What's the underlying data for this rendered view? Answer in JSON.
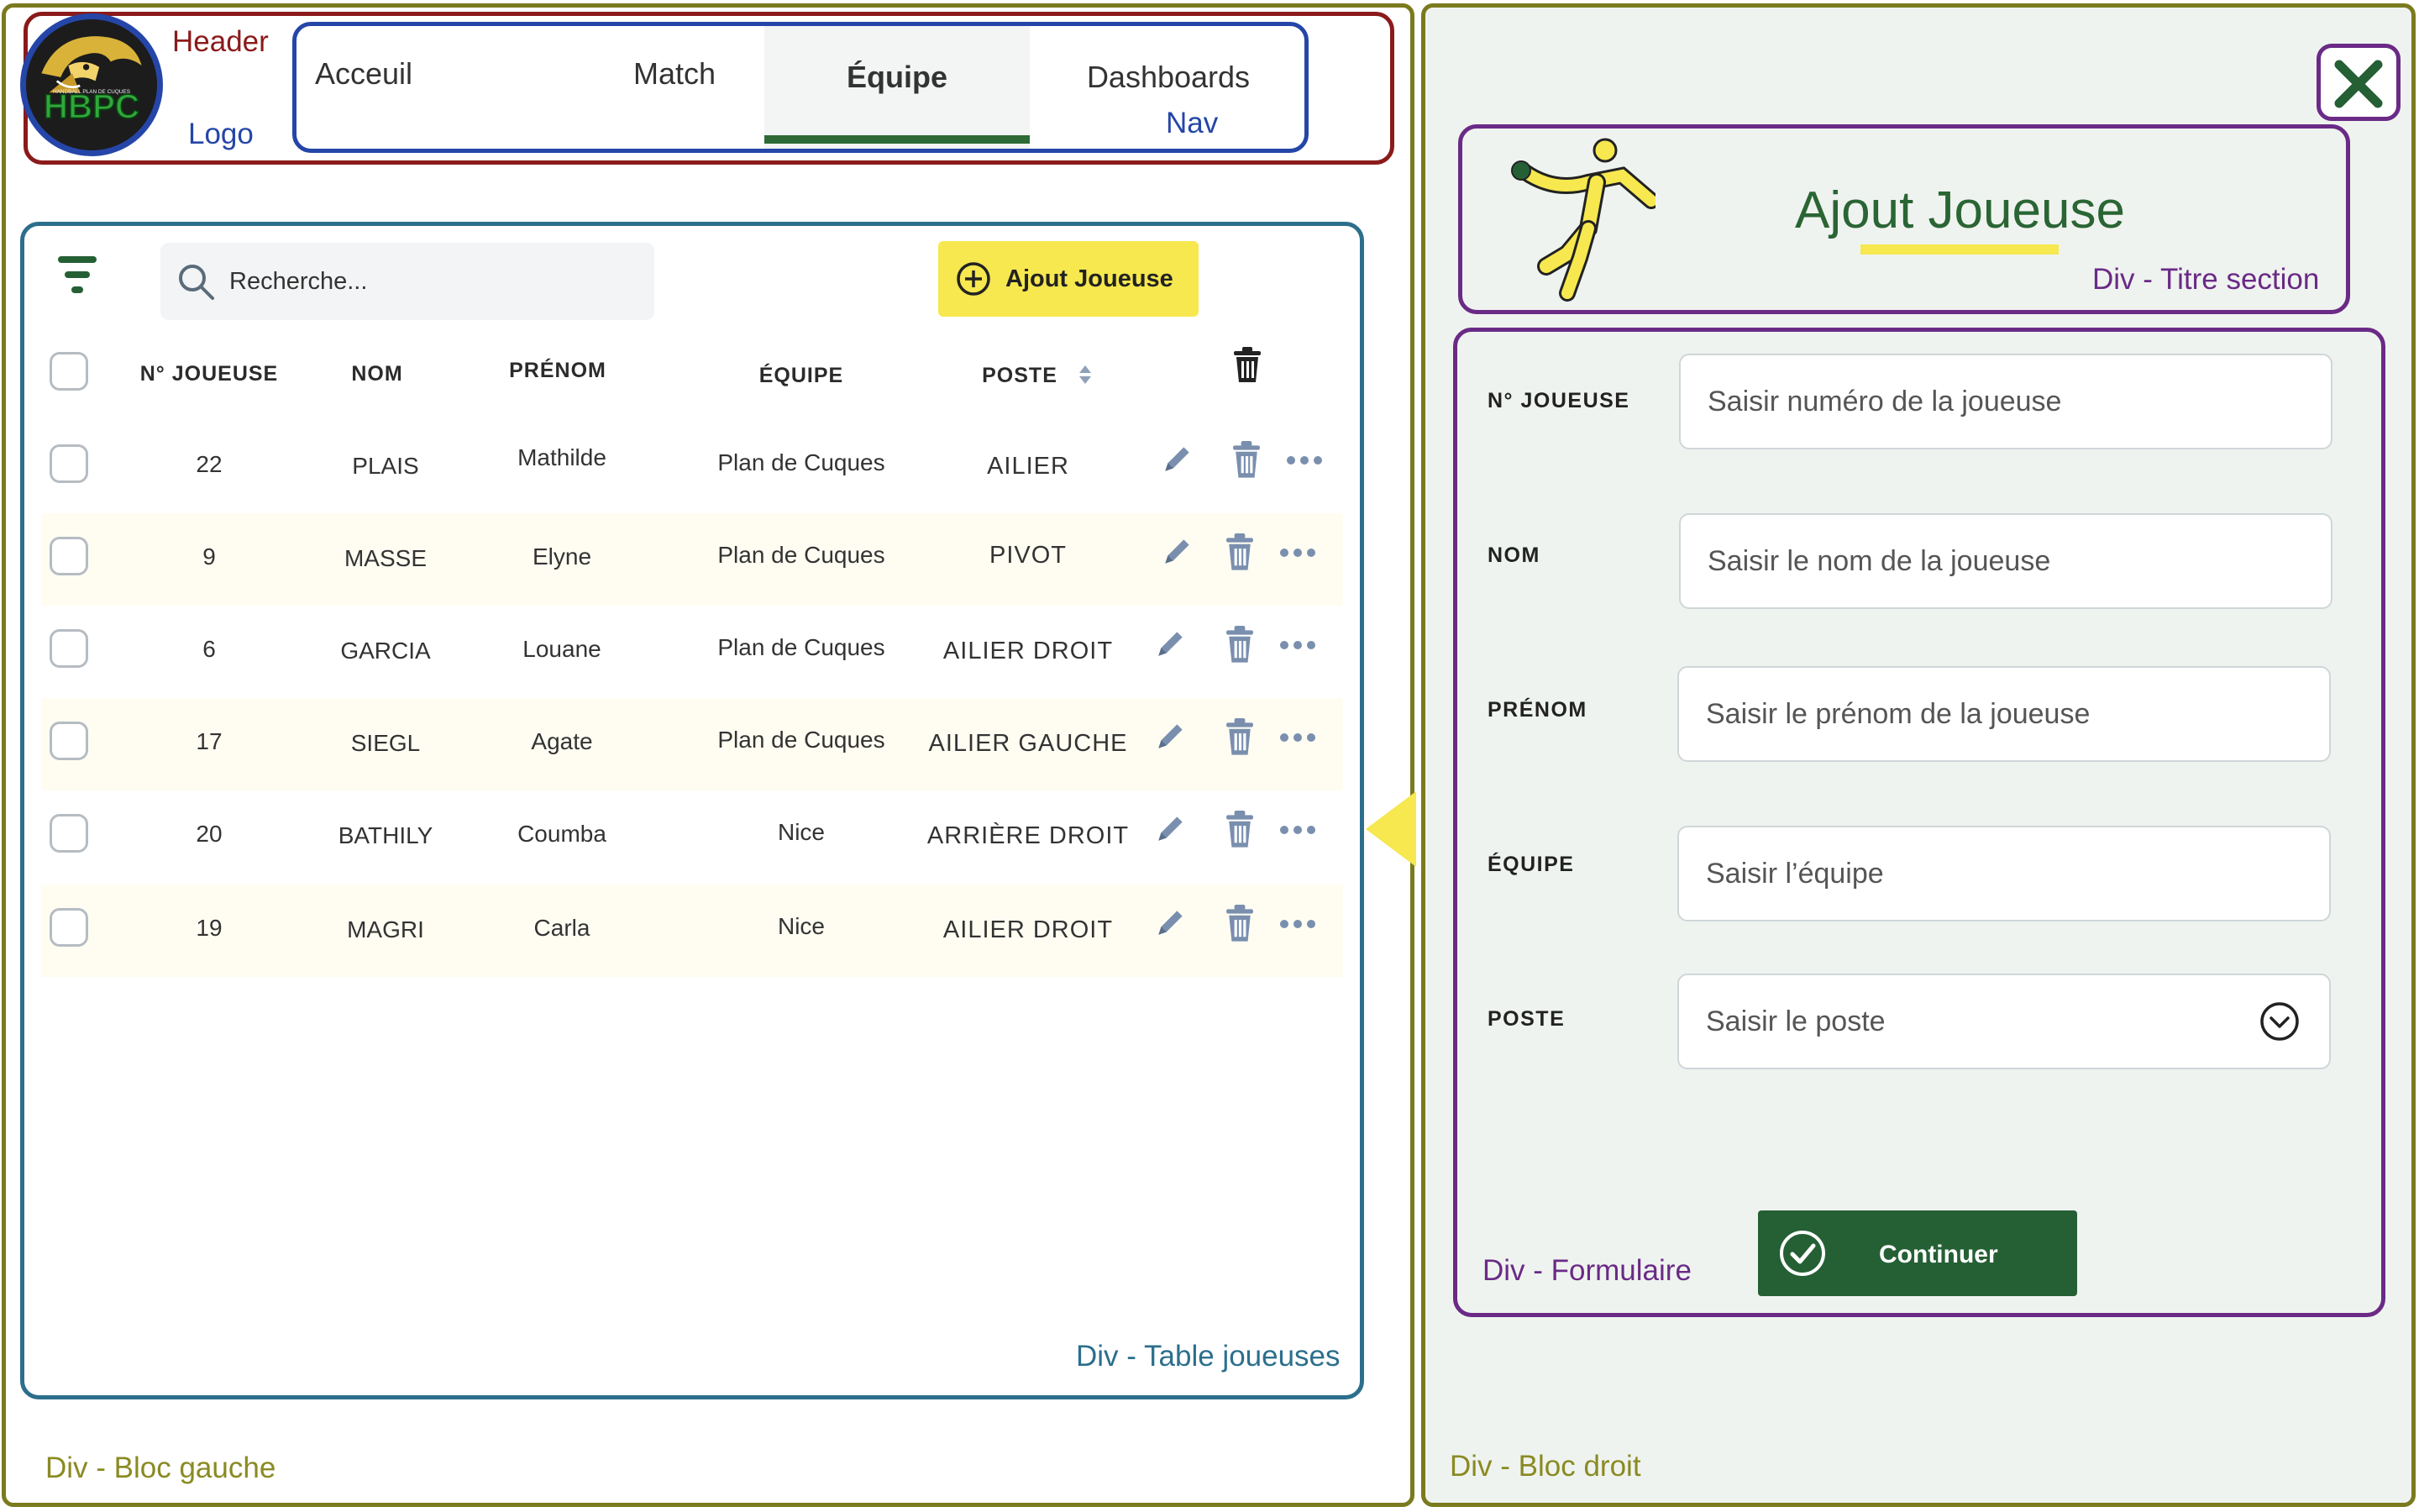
{
  "annotations": {
    "header": "Header",
    "logo": "Logo",
    "nav": "Nav",
    "table": "Div - Table joueuses",
    "bloc_gauche": "Div - Bloc gauche",
    "bloc_droit": "Div - Bloc droit",
    "titre_section": "Div - Titre section",
    "formulaire": "Div - Formulaire"
  },
  "logo": {
    "text": "HBPC",
    "ring_text": "HANDBALL PLAN DE CUQUES"
  },
  "nav": {
    "items": [
      {
        "label": "Acceuil",
        "active": false
      },
      {
        "label": "Match",
        "active": false
      },
      {
        "label": "Équipe",
        "active": true
      },
      {
        "label": "Dashboards",
        "active": false
      }
    ]
  },
  "toolbar": {
    "search_placeholder": "Recherche...",
    "add_label": "Ajout Joueuse"
  },
  "table": {
    "headers": [
      "N° JOUEUSE",
      "NOM",
      "PRÉNOM",
      "ÉQUIPE",
      "POSTE"
    ],
    "rows": [
      {
        "numero": "22",
        "nom": "PLAIS",
        "prenom": "Mathilde",
        "equipe": "Plan de Cuques",
        "poste": "AILIER"
      },
      {
        "numero": "9",
        "nom": "MASSE",
        "prenom": "Elyne",
        "equipe": "Plan de Cuques",
        "poste": "PIVOT"
      },
      {
        "numero": "6",
        "nom": "GARCIA",
        "prenom": "Louane",
        "equipe": "Plan de Cuques",
        "poste": "AILIER DROIT"
      },
      {
        "numero": "17",
        "nom": "SIEGL",
        "prenom": "Agate",
        "equipe": "Plan de Cuques",
        "poste": "AILIER GAUCHE"
      },
      {
        "numero": "20",
        "nom": "BATHILY",
        "prenom": "Coumba",
        "equipe": "Nice",
        "poste": "ARRIÈRE DROIT"
      },
      {
        "numero": "19",
        "nom": "MAGRI",
        "prenom": "Carla",
        "equipe": "Nice",
        "poste": "AILIER DROIT"
      }
    ]
  },
  "section": {
    "title": "Ajout Joueuse"
  },
  "form": {
    "fields": [
      {
        "label": "N° JOUEUSE",
        "placeholder": "Saisir numéro de la joueuse"
      },
      {
        "label": "NOM",
        "placeholder": "Saisir le nom de la joueuse"
      },
      {
        "label": "PRÉNOM",
        "placeholder": "Saisir le prénom de la joueuse"
      },
      {
        "label": "ÉQUIPE",
        "placeholder": "Saisir l’équipe"
      },
      {
        "label": "POSTE",
        "placeholder": "Saisir le poste"
      }
    ],
    "submit_label": "Continuer"
  },
  "colors": {
    "brand_green": "#256035",
    "accent_yellow": "#f6e84e",
    "header_border": "#8b1a1a",
    "nav_border": "#2546a8",
    "table_border": "#2c6f8c",
    "form_border": "#6a2a86",
    "bloc_border": "#7a7a1e"
  }
}
